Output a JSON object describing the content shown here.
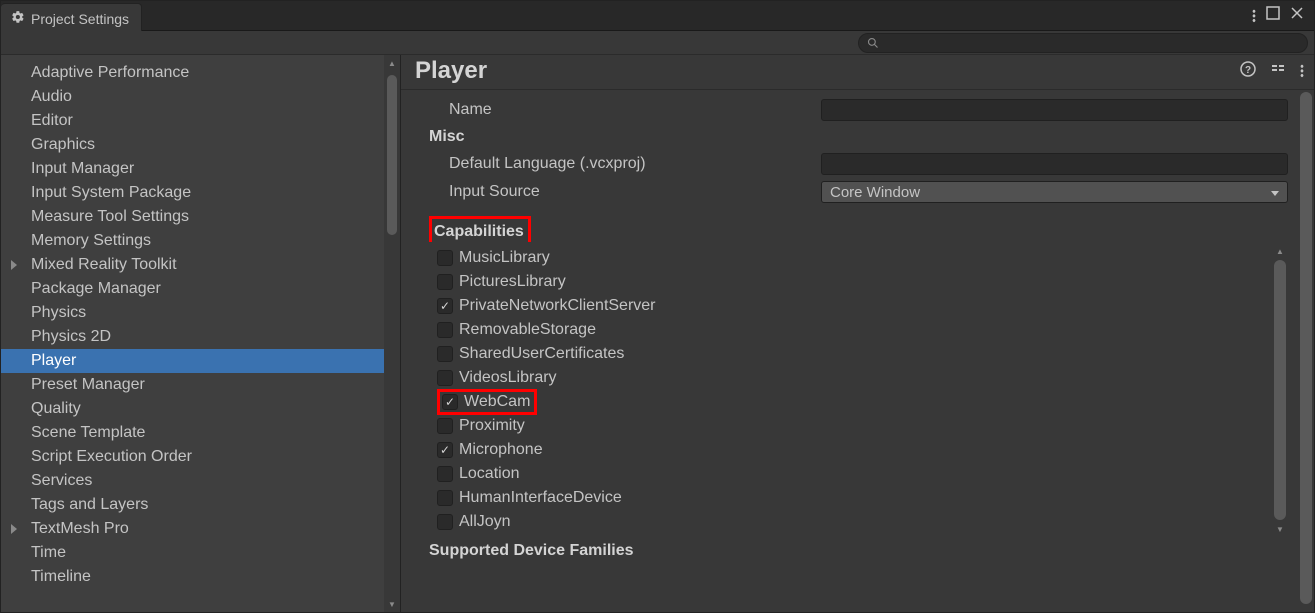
{
  "window": {
    "title": "Project Settings"
  },
  "search": {
    "placeholder": ""
  },
  "sidebar": {
    "items": [
      {
        "label": "Adaptive Performance",
        "expandable": false
      },
      {
        "label": "Audio",
        "expandable": false
      },
      {
        "label": "Editor",
        "expandable": false
      },
      {
        "label": "Graphics",
        "expandable": false
      },
      {
        "label": "Input Manager",
        "expandable": false
      },
      {
        "label": "Input System Package",
        "expandable": false
      },
      {
        "label": "Measure Tool Settings",
        "expandable": false
      },
      {
        "label": "Memory Settings",
        "expandable": false
      },
      {
        "label": "Mixed Reality Toolkit",
        "expandable": true
      },
      {
        "label": "Package Manager",
        "expandable": false
      },
      {
        "label": "Physics",
        "expandable": false
      },
      {
        "label": "Physics 2D",
        "expandable": false
      },
      {
        "label": "Player",
        "expandable": false,
        "selected": true
      },
      {
        "label": "Preset Manager",
        "expandable": false
      },
      {
        "label": "Quality",
        "expandable": false
      },
      {
        "label": "Scene Template",
        "expandable": false
      },
      {
        "label": "Script Execution Order",
        "expandable": false
      },
      {
        "label": "Services",
        "expandable": false
      },
      {
        "label": "Tags and Layers",
        "expandable": false
      },
      {
        "label": "TextMesh Pro",
        "expandable": true
      },
      {
        "label": "Time",
        "expandable": false
      },
      {
        "label": "Timeline",
        "expandable": false
      }
    ]
  },
  "main": {
    "title": "Player",
    "name_field": {
      "label": "Name",
      "value": ""
    },
    "misc_label": "Misc",
    "default_language": {
      "label": "Default Language (.vcxproj)",
      "value": ""
    },
    "input_source": {
      "label": "Input Source",
      "value": "Core Window"
    },
    "capabilities_label": "Capabilities",
    "capabilities": [
      {
        "label": "MusicLibrary",
        "checked": false
      },
      {
        "label": "PicturesLibrary",
        "checked": false
      },
      {
        "label": "PrivateNetworkClientServer",
        "checked": true
      },
      {
        "label": "RemovableStorage",
        "checked": false
      },
      {
        "label": "SharedUserCertificates",
        "checked": false
      },
      {
        "label": "VideosLibrary",
        "checked": false
      },
      {
        "label": "WebCam",
        "checked": true,
        "highlighted": true
      },
      {
        "label": "Proximity",
        "checked": false
      },
      {
        "label": "Microphone",
        "checked": true
      },
      {
        "label": "Location",
        "checked": false
      },
      {
        "label": "HumanInterfaceDevice",
        "checked": false
      },
      {
        "label": "AllJoyn",
        "checked": false
      }
    ],
    "supported_families_label": "Supported Device Families"
  }
}
